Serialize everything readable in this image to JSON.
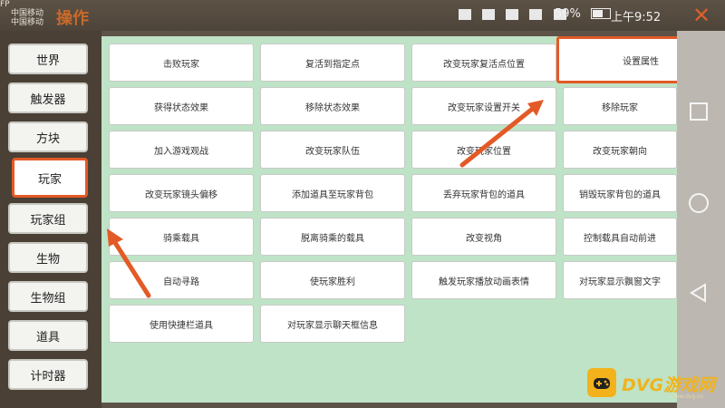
{
  "title_overlay": {
    "line1": "FP",
    "line2": "中国移动",
    "line3": "中国移动",
    "partial_title": "操作"
  },
  "status_bar": {
    "battery": "59%",
    "time": "上午9:52",
    "icons": [
      "hd-icon",
      "eye-icon",
      "signal-4g-icon",
      "signal-2g-icon",
      "battery-icon"
    ]
  },
  "nav": {
    "items": [
      {
        "label": "世界"
      },
      {
        "label": "触发器"
      },
      {
        "label": "方块"
      },
      {
        "label": "玩家"
      },
      {
        "label": "玩家组"
      },
      {
        "label": "生物"
      },
      {
        "label": "生物组"
      },
      {
        "label": "道具"
      },
      {
        "label": "计时器"
      }
    ],
    "selected": "玩家"
  },
  "commands": [
    [
      "击败玩家",
      "复活到指定点",
      "改变玩家复活点位置",
      "设置属性"
    ],
    [
      "获得状态效果",
      "移除状态效果",
      "改变玩家设置开关",
      "移除玩家"
    ],
    [
      "加入游戏观战",
      "改变玩家队伍",
      "改变玩家位置",
      "改变玩家朝向"
    ],
    [
      "改变玩家镜头偏移",
      "添加道具至玩家背包",
      "丢弃玩家背包的道具",
      "销毁玩家背包的道具"
    ],
    [
      "骑乘载具",
      "脱离骑乘的载具",
      "改变视角",
      "控制载具自动前进"
    ],
    [
      "自动寻路",
      "使玩家胜利",
      "触发玩家播放动画表情",
      "对玩家显示飘窗文字"
    ],
    [
      "使用快捷栏道具",
      "对玩家显示聊天框信息"
    ]
  ],
  "highlighted_command": "设置属性",
  "colors": {
    "accent": "#e35a26",
    "panel": "#bfe3c6",
    "nav_bg": "#4a4036"
  },
  "watermark": {
    "text": "DVG游戏网",
    "url": "www.dvg.cn",
    "icon": "gamepad-icon"
  }
}
